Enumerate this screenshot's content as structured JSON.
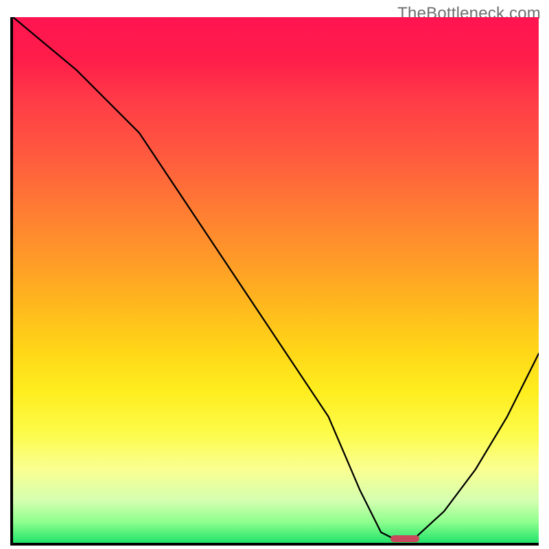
{
  "watermark": "TheBottleneck.com",
  "colors": {
    "axis": "#000000",
    "curve": "#000000",
    "marker": "#c9485b",
    "gradient_stops": [
      "#ff1450",
      "#ff1d4a",
      "#ff3c47",
      "#ff593f",
      "#ff7a34",
      "#ff9a28",
      "#ffb91d",
      "#ffd518",
      "#feed1e",
      "#fdfb49",
      "#faff91",
      "#d4ffb0",
      "#8fff8e",
      "#21e36b"
    ]
  },
  "chart_data": {
    "type": "line",
    "title": "",
    "xlabel": "",
    "ylabel": "",
    "xlim": [
      0,
      100
    ],
    "ylim": [
      0,
      100
    ],
    "grid": false,
    "legend": false,
    "background": "vertical gradient red→green (top→bottom)",
    "series": [
      {
        "name": "bottleneck-curve",
        "x": [
          0,
          12,
          24,
          36,
          48,
          60,
          66,
          70,
          73,
          76,
          82,
          88,
          94,
          100
        ],
        "y": [
          100,
          90,
          78,
          60,
          42,
          24,
          10,
          2,
          0.5,
          0.5,
          6,
          14,
          24,
          36
        ]
      }
    ],
    "annotations": [
      {
        "name": "optimal-marker",
        "shape": "pill",
        "x_center": 74.5,
        "y_center": 0.8,
        "width_pct": 5.5,
        "height_pct": 1.4,
        "color": "#c9485b"
      }
    ]
  }
}
